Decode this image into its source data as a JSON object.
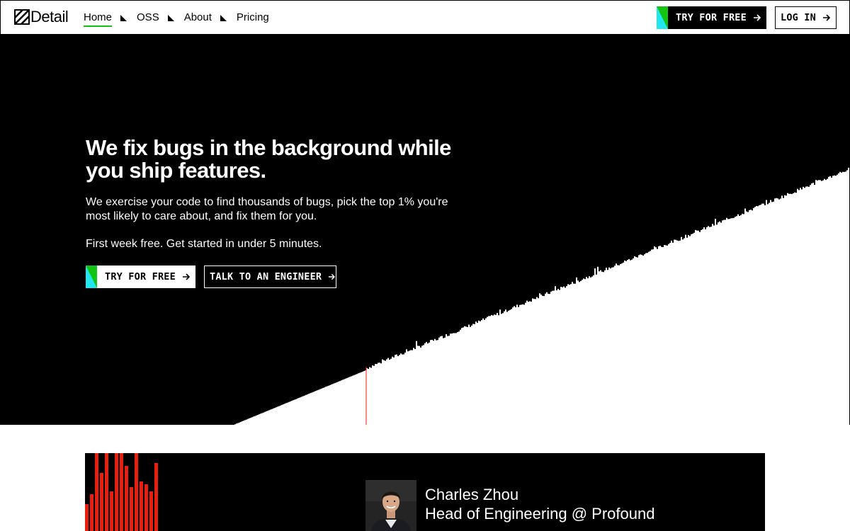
{
  "brand": {
    "name": "Detail",
    "logo_icon": "hatched-square-icon"
  },
  "nav": {
    "links": [
      {
        "label": "Home",
        "active": true
      },
      {
        "label": "OSS",
        "active": false
      },
      {
        "label": "About",
        "active": false
      },
      {
        "label": "Pricing",
        "active": false
      }
    ],
    "try_label": "TRY FOR FREE",
    "login_label": "LOG IN"
  },
  "hero": {
    "title": "We fix bugs in the background while you ship features.",
    "subtitle": "We exercise your code to find thousands of bugs, pick the top 1% you're most likely to care about, and fix them for you.",
    "note": "First week free. Get started in under 5 minutes.",
    "try_label": "TRY FOR FREE",
    "talk_label": "TALK TO AN ENGINEER"
  },
  "testimonial": {
    "name": "Charles Zhou",
    "role": "Head of Engineering @ Profound"
  },
  "colors": {
    "accent_green": "#14c414",
    "accent_cyan": "#22e6f0",
    "bug_red": "#e81e0e",
    "background_dark": "#000000",
    "background_light": "#ffffff"
  }
}
